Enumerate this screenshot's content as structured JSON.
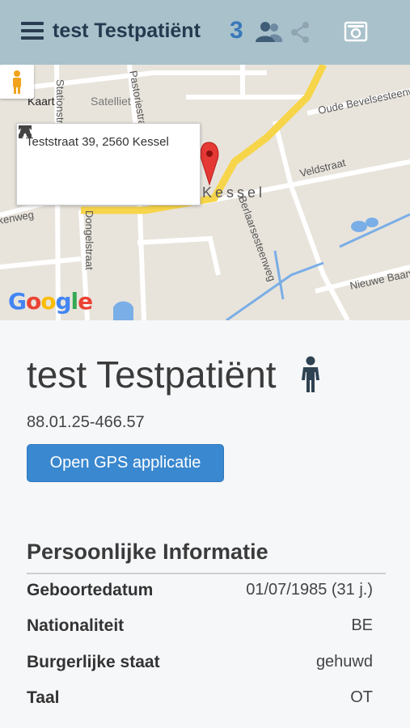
{
  "header": {
    "title": "test Testpatiënt",
    "count": "3"
  },
  "map": {
    "tab_map": "Kaart",
    "tab_satellite": "Satelliet",
    "popup_address": "Teststraat 39, 2560 Kessel",
    "logo": "Google",
    "streets": {
      "oude_bevelse": "Oude Bevelsesteenweg",
      "veldstraat": "Veldstraat",
      "berlaar": "Berlaarsesteenweg",
      "dongelstraat": "Dongelstraat",
      "stationstraat": "Stationstraat",
      "pastorie": "Pastoriestraat",
      "kessel": "Kessel",
      "akenweg": "akenweg",
      "nieuwe": "Nieuwe Baan"
    }
  },
  "patient": {
    "name": "test Testpatiënt",
    "id": "88.01.25-466.57",
    "gps_button": "Open GPS applicatie"
  },
  "personal_info": {
    "title": "Persoonlijke Informatie",
    "rows": [
      {
        "label": "Geboortedatum",
        "value": "01/07/1985 (31 j.)"
      },
      {
        "label": "Nationaliteit",
        "value": "BE"
      },
      {
        "label": "Burgerlijke staat",
        "value": "gehuwd"
      },
      {
        "label": "Taal",
        "value": "OT"
      }
    ]
  },
  "colors": {
    "header_bg": "#a8c1cb",
    "title": "#25394f",
    "count": "#3a78b8",
    "button": "#3a88cf",
    "marker": "#e53935",
    "road_major": "#f7d54a"
  },
  "icons": [
    "menu-icon",
    "group-icon",
    "share-icon",
    "camera-icon",
    "navigation-icon",
    "expand-icon",
    "map-marker-icon",
    "pegman-icon",
    "person-icon"
  ]
}
